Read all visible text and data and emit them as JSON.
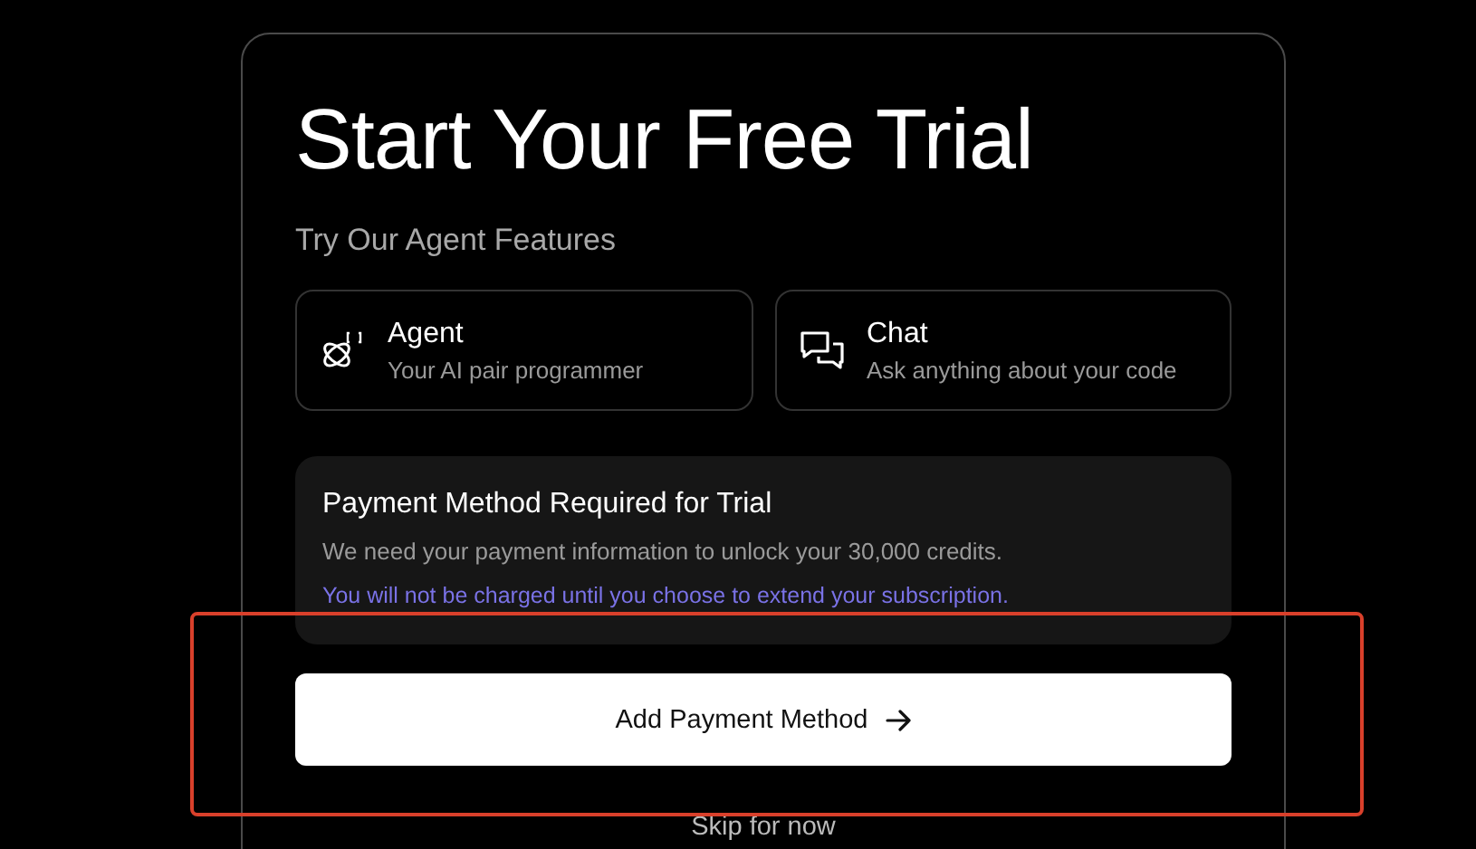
{
  "title": "Start Your Free Trial",
  "subtitle": "Try Our Agent Features",
  "features": [
    {
      "kind": "agent",
      "name": "Agent",
      "description": "Your AI pair programmer"
    },
    {
      "kind": "chat",
      "name": "Chat",
      "description": "Ask anything about your code"
    }
  ],
  "notice": {
    "title": "Payment Method Required for Trial",
    "body": "We need your payment information to unlock your 30,000 credits.",
    "link": "You will not be charged until you choose to extend your subscription."
  },
  "primary_button": {
    "label": "Add Payment Method"
  },
  "skip_link": "Skip for now"
}
